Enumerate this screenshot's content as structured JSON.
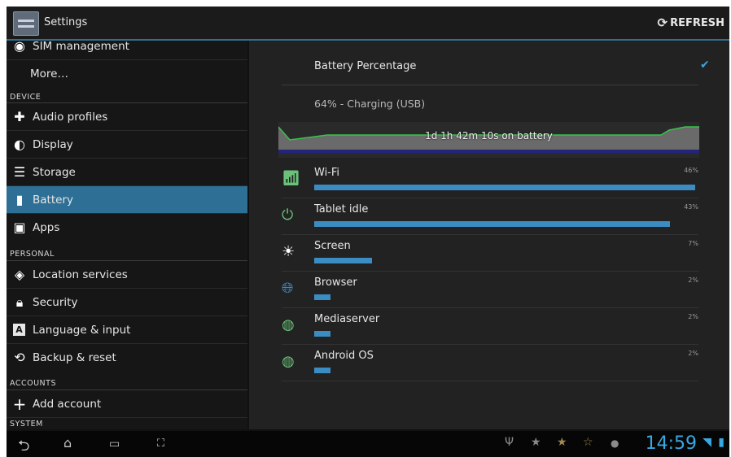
{
  "actionbar": {
    "title": "Settings",
    "refresh_label": "REFRESH",
    "refresh_icon": "refresh-icon"
  },
  "sidebar": {
    "items_top": [
      {
        "label": "SIM management",
        "icon": "sim-icon"
      },
      {
        "label": "More…",
        "icon": ""
      }
    ],
    "headers": {
      "device": "DEVICE",
      "personal": "PERSONAL",
      "accounts": "ACCOUNTS",
      "system": "SYSTEM"
    },
    "device_items": [
      {
        "label": "Audio profiles",
        "icon": "audio-profiles-icon"
      },
      {
        "label": "Display",
        "icon": "display-icon"
      },
      {
        "label": "Storage",
        "icon": "storage-icon"
      },
      {
        "label": "Battery",
        "icon": "battery-icon",
        "active": true
      },
      {
        "label": "Apps",
        "icon": "apps-icon"
      }
    ],
    "personal_items": [
      {
        "label": "Location services",
        "icon": "location-icon"
      },
      {
        "label": "Security",
        "icon": "lock-icon"
      },
      {
        "label": "Language & input",
        "icon": "language-icon"
      },
      {
        "label": "Backup & reset",
        "icon": "backup-icon"
      }
    ],
    "account_items": [
      {
        "label": "Add account",
        "icon": "plus-icon"
      }
    ]
  },
  "battery": {
    "percentage_label": "Battery Percentage",
    "percentage_checked": true,
    "status": "64% - Charging (USB)",
    "graph_label": "1d 1h 42m 10s on battery",
    "usage": [
      {
        "name": "Wi-Fi",
        "percent": "46%",
        "fraction": 0.46,
        "icon": "wifi-app-icon"
      },
      {
        "name": "Tablet idle",
        "percent": "43%",
        "fraction": 0.43,
        "icon": "power-icon"
      },
      {
        "name": "Screen",
        "percent": "7%",
        "fraction": 0.07,
        "icon": "brightness-icon"
      },
      {
        "name": "Browser",
        "percent": "2%",
        "fraction": 0.02,
        "icon": "globe-icon"
      },
      {
        "name": "Mediaserver",
        "percent": "2%",
        "fraction": 0.02,
        "icon": "android-icon"
      },
      {
        "name": "Android OS",
        "percent": "2%",
        "fraction": 0.02,
        "icon": "android-icon"
      }
    ]
  },
  "navbar": {
    "buttons": [
      "back-icon",
      "home-icon",
      "recent-apps-icon",
      "screenshot-icon"
    ],
    "clock": "14:59",
    "colors": {
      "accent": "#39a7e0",
      "active_item": "#2e6f96",
      "bar": "#3c8cc4"
    }
  }
}
